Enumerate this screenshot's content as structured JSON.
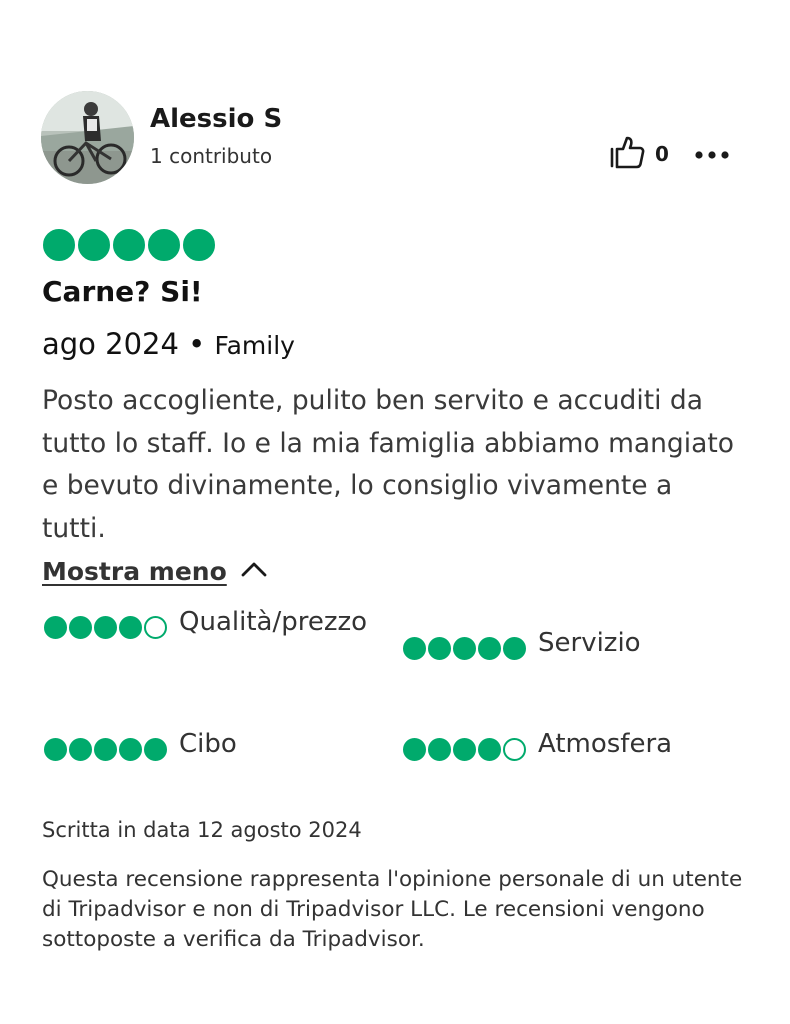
{
  "author": {
    "name": "Alessio S",
    "contributions": "1 contributo"
  },
  "helpful": {
    "count": "0",
    "icon": "thumbs-up-icon"
  },
  "more_icon": "more-options-icon",
  "review": {
    "rating": 5,
    "title": "Carne? Si!",
    "date": "ago 2024",
    "separator": "•",
    "trip_type": "Family",
    "text": "Posto accogliente, pulito ben servito e accuditi da tutto lo staff. Io e la mia famiglia abbiamo mangiato e bevuto divinamente, lo consiglio vivamente a tutti.",
    "show_less_label": "Mostra meno"
  },
  "subratings": [
    {
      "label": "Qualità/prezzo",
      "rating": 4
    },
    {
      "label": "Servizio",
      "rating": 5
    },
    {
      "label": "Cibo",
      "rating": 5
    },
    {
      "label": "Atmosfera",
      "rating": 4
    }
  ],
  "written_date": "Scritta in data 12 agosto 2024",
  "disclaimer": "Questa recensione rappresenta l'opinione personale di un utente di Tripadvisor e non di Tripadvisor LLC. Le recensioni vengono sottoposte a verifica da Tripadvisor.",
  "colors": {
    "bubble_green": "#00aa6c",
    "text": "#1a1a1a"
  }
}
